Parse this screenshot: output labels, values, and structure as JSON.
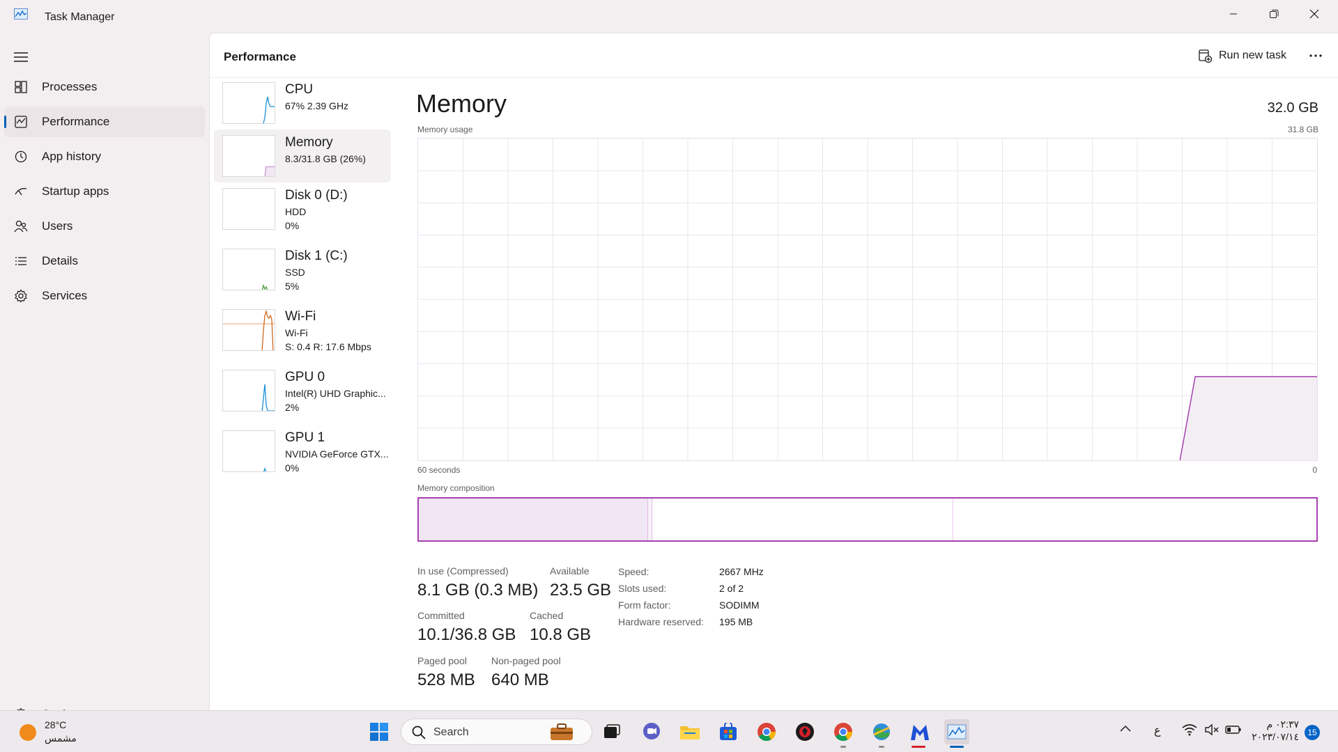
{
  "window": {
    "title": "Task Manager"
  },
  "sidebar": {
    "items": [
      {
        "label": "Processes",
        "icon": "processes-icon"
      },
      {
        "label": "Performance",
        "icon": "performance-icon",
        "active": true
      },
      {
        "label": "App history",
        "icon": "app-history-icon"
      },
      {
        "label": "Startup apps",
        "icon": "startup-apps-icon"
      },
      {
        "label": "Users",
        "icon": "users-icon"
      },
      {
        "label": "Details",
        "icon": "details-icon"
      },
      {
        "label": "Services",
        "icon": "services-icon"
      }
    ],
    "settings_label": "Settings"
  },
  "header": {
    "title": "Performance",
    "run_new_task": "Run new task"
  },
  "devices": [
    {
      "name": "CPU",
      "line1": "67%  2.39 GHz",
      "line2": ""
    },
    {
      "name": "Memory",
      "line1": "8.3/31.8 GB (26%)",
      "line2": "",
      "active": true
    },
    {
      "name": "Disk 0 (D:)",
      "line1": "HDD",
      "line2": "0%"
    },
    {
      "name": "Disk 1 (C:)",
      "line1": "SSD",
      "line2": "5%"
    },
    {
      "name": "Wi-Fi",
      "line1": "Wi-Fi",
      "line2": "S: 0.4  R: 17.6 Mbps"
    },
    {
      "name": "GPU 0",
      "line1": "Intel(R) UHD Graphic...",
      "line2": "2%"
    },
    {
      "name": "GPU 1",
      "line1": "NVIDIA GeForce GTX...",
      "line2": "0%"
    }
  ],
  "memory": {
    "title": "Memory",
    "total": "32.0 GB",
    "usage_label": "Memory usage",
    "usage_max": "31.8 GB",
    "time_left": "60 seconds",
    "time_right": "0",
    "composition_label": "Memory composition",
    "stats": {
      "in_use_label": "In use (Compressed)",
      "in_use_value": "8.1 GB (0.3 MB)",
      "available_label": "Available",
      "available_value": "23.5 GB",
      "committed_label": "Committed",
      "committed_value": "10.1/36.8 GB",
      "cached_label": "Cached",
      "cached_value": "10.8 GB",
      "paged_label": "Paged pool",
      "paged_value": "528 MB",
      "nonpaged_label": "Non-paged pool",
      "nonpaged_value": "640 MB"
    },
    "specs": {
      "speed_label": "Speed:",
      "speed_value": "2667 MHz",
      "slots_label": "Slots used:",
      "slots_value": "2 of 2",
      "form_label": "Form factor:",
      "form_value": "SODIMM",
      "reserved_label": "Hardware reserved:",
      "reserved_value": "195 MB"
    },
    "usage_history_fraction": [
      0,
      0,
      0,
      0,
      0,
      0,
      0,
      0,
      0,
      0,
      0,
      0,
      0,
      0,
      0,
      0,
      0,
      0,
      0,
      0,
      0,
      0,
      0,
      0,
      0,
      0,
      0,
      0,
      0,
      0,
      0,
      0,
      0,
      0,
      0,
      0,
      0,
      0,
      0,
      0,
      0,
      0,
      0,
      0,
      0,
      0,
      0,
      0,
      0,
      0,
      0,
      0.26,
      0.26,
      0.26,
      0.26,
      0.26,
      0.26,
      0.26,
      0.26,
      0.26
    ],
    "composition_fractions": {
      "in_use": 0.255,
      "modified": 0.005,
      "standby": 0.335,
      "free": 0.405
    }
  },
  "accent_color": "#a640b0",
  "taskbar": {
    "weather_temp": "28°C",
    "weather_cond": "مشمس",
    "search_label": "Search",
    "lang": "ع",
    "time": "٠٢:٣٧ م",
    "date": "٢٠٢٣/٠٧/١٤",
    "notifications": "15"
  }
}
